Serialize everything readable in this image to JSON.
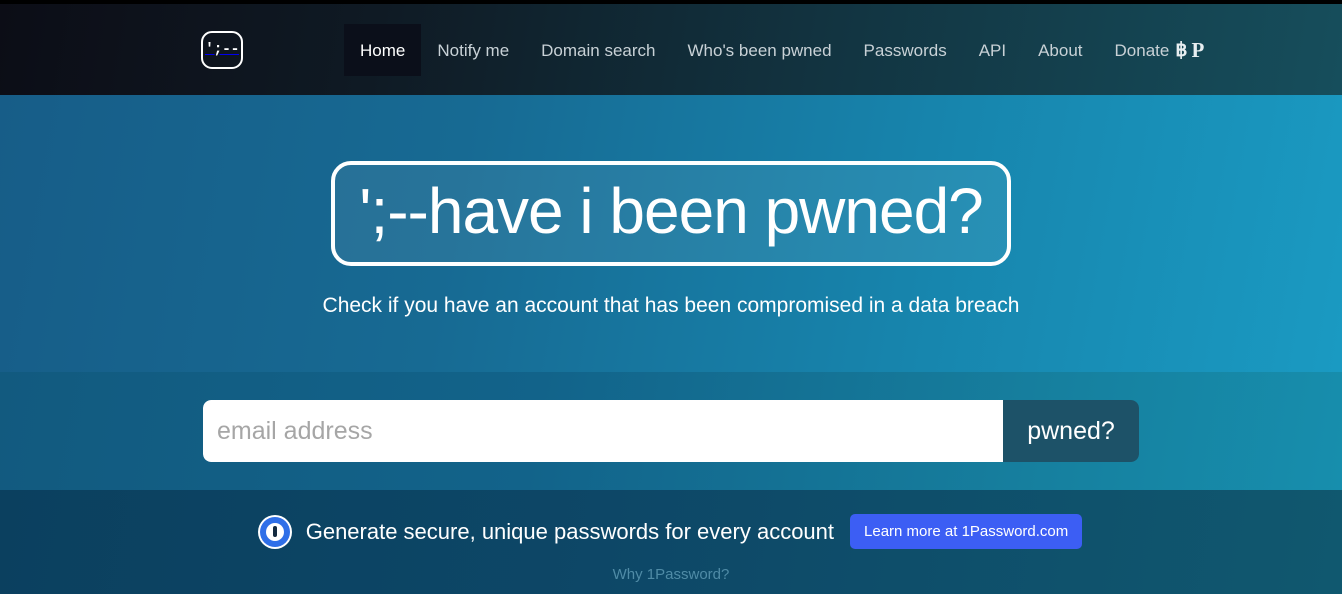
{
  "nav": {
    "logo_text": "';--",
    "logo_name": "hibp-logo",
    "items": [
      {
        "label": "Home",
        "active": true
      },
      {
        "label": "Notify me",
        "active": false
      },
      {
        "label": "Domain search",
        "active": false
      },
      {
        "label": "Who's been pwned",
        "active": false
      },
      {
        "label": "Passwords",
        "active": false
      },
      {
        "label": "API",
        "active": false
      },
      {
        "label": "About",
        "active": false
      }
    ],
    "donate": {
      "label": "Donate",
      "bitcoin_icon": "฿",
      "paypal_icon": "P"
    }
  },
  "hero": {
    "title": "';--have i been pwned?",
    "subtitle": "Check if you have an account that has been compromised in a data breach"
  },
  "search": {
    "placeholder": "email address",
    "value": "",
    "button_label": "pwned?"
  },
  "promo": {
    "logo_name": "1password-logo",
    "text": "Generate secure, unique passwords for every account",
    "button_label": "Learn more at 1Password.com",
    "link_label": "Why 1Password?"
  },
  "colors": {
    "nav_dark": "#0c0d16",
    "nav_teal": "#164e5c",
    "hero_left": "#175d88",
    "hero_right": "#1a9ac2",
    "pwned_button": "#1d5268",
    "promo_button": "#3c5ef4",
    "promo_band": "#0d4767",
    "link_muted": "#4f8ba6"
  }
}
